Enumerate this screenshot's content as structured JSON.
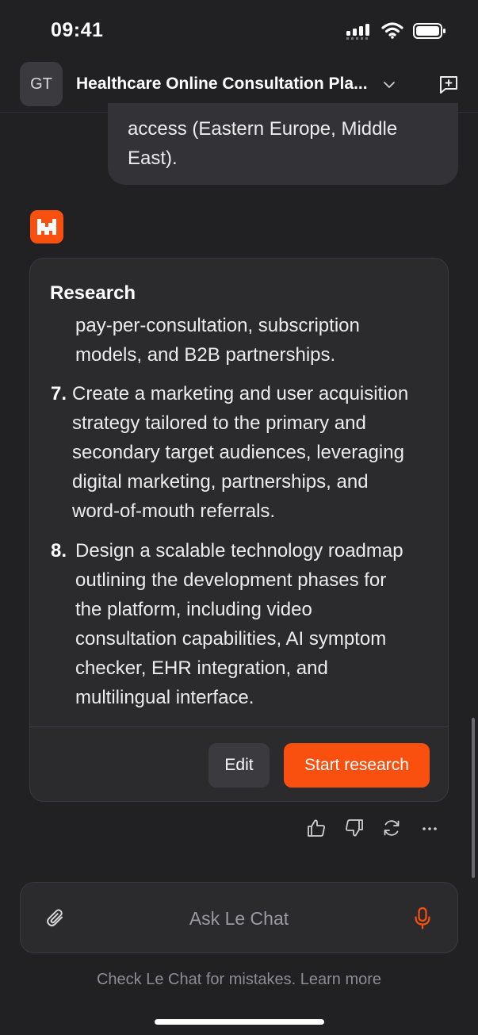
{
  "status_bar": {
    "time": "09:41"
  },
  "header": {
    "avatar_initials": "GT",
    "title": "Healthcare Online Consultation Pla...",
    "chevron_icon": "chevron-down-icon",
    "new_chat_icon": "new-chat-icon"
  },
  "user_message": {
    "lines": [
      "access (Eastern Europe, Middle",
      "East)."
    ]
  },
  "assistant": {
    "logo_icon": "le-chat-logo",
    "research_card": {
      "title": "Research",
      "continued_lines": [
        "pay-per-consultation, subscription",
        "models, and B2B partnerships."
      ],
      "items": [
        {
          "number": "7.",
          "lines": [
            "Create a marketing and user acquisition",
            "strategy tailored to the primary and",
            "secondary target audiences, leveraging",
            "digital marketing, partnerships, and",
            "word-of-mouth referrals."
          ]
        },
        {
          "number": "8.",
          "lines": [
            "Design a scalable technology roadmap",
            "outlining the development phases for",
            "the platform, including video",
            "consultation capabilities, AI symptom",
            "checker, EHR integration, and",
            "multilingual interface."
          ]
        }
      ],
      "edit_label": "Edit",
      "start_label": "Start research"
    },
    "feedback_icons": [
      "thumbs-up-icon",
      "thumbs-down-icon",
      "regenerate-icon",
      "more-icon"
    ]
  },
  "composer": {
    "placeholder": "Ask Le Chat",
    "attach_icon": "paperclip-icon",
    "mic_icon": "microphone-icon"
  },
  "disclaimer": "Check Le Chat for mistakes. Learn more",
  "colors": {
    "background": "#212023",
    "accent": "#fa500f",
    "card": "#2b2a2d"
  }
}
